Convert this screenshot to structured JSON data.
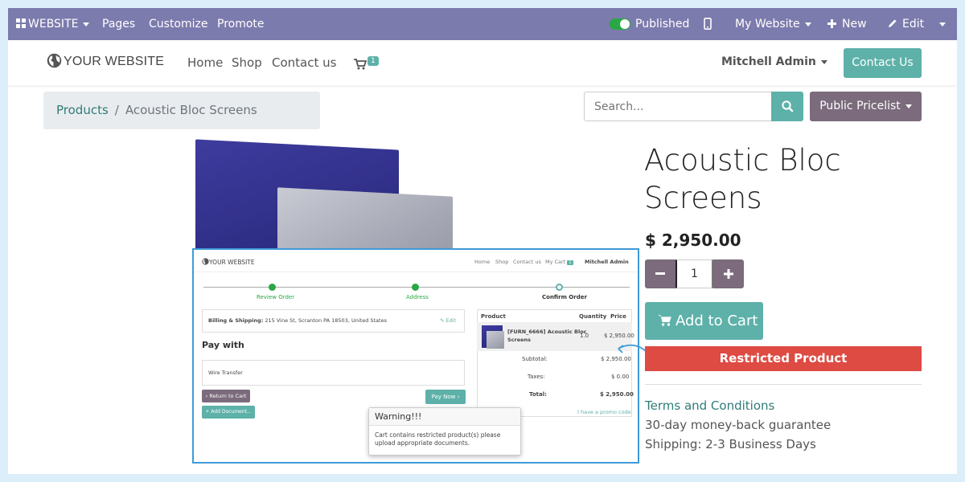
{
  "admin_bar": {
    "website_menu": "WEBSITE",
    "pages": "Pages",
    "customize": "Customize",
    "promote": "Promote",
    "published": "Published",
    "my_website": "My Website",
    "new": "New",
    "edit": "Edit",
    "background": "#7c7bad"
  },
  "header": {
    "logo": "YOUR WEBSITE",
    "nav": [
      "Home",
      "Shop",
      "Contact us"
    ],
    "cart_count": "1",
    "user": "Mitchell Admin",
    "contact_button": "Contact Us"
  },
  "breadcrumb": {
    "parent": "Products",
    "separator": "/",
    "current": "Acoustic Bloc Screens"
  },
  "search": {
    "placeholder": "Search..."
  },
  "pricelist": "Public Pricelist",
  "product": {
    "title": "Acoustic Bloc Screens",
    "price": "$ 2,950.00",
    "quantity": "1",
    "add_to_cart": "Add to Cart",
    "restricted": "Restricted Product",
    "terms": "Terms and Conditions",
    "guarantee": "30-day money-back guarantee",
    "shipping": "Shipping: 2-3 Business Days"
  },
  "inset": {
    "logo": "YOUR WEBSITE",
    "nav": [
      "Home",
      "Shop",
      "Contact us",
      "My Cart"
    ],
    "cart_count": "1",
    "user": "Mitchell Admin",
    "steps": [
      "Review Order",
      "Address",
      "Confirm Order"
    ],
    "billing_label": "Billing & Shipping:",
    "billing_address": "215 Vine St, Scranton PA 18503, United States",
    "edit": "Edit",
    "pay_with": "Pay with",
    "payment_method": "Wire Transfer",
    "return_to_cart": "Return to Cart",
    "add_document": "Add Document...",
    "pay_now": "Pay Now",
    "table": {
      "headers": [
        "Product",
        "Quantity",
        "Price"
      ],
      "product_line1": "[FURN_6666] Acoustic Bloc",
      "product_line2": "Screens",
      "quantity": "1.0",
      "price": "$ 2,950.00",
      "subtotal_label": "Subtotal:",
      "subtotal": "$ 2,950.00",
      "taxes_label": "Taxes:",
      "taxes": "$ 0.00",
      "total_label": "Total:",
      "total": "$ 2,950.00"
    },
    "promo": "I have a promo code",
    "warning_title": "Warning!!!",
    "warning_text": "Cart contains restricted product(s) please upload appropriate documents."
  },
  "colors": {
    "accent": "#5db1a9",
    "secondary": "#7b6b7c",
    "danger": "#dd4b43",
    "highlight_border": "#3f9ad8"
  }
}
